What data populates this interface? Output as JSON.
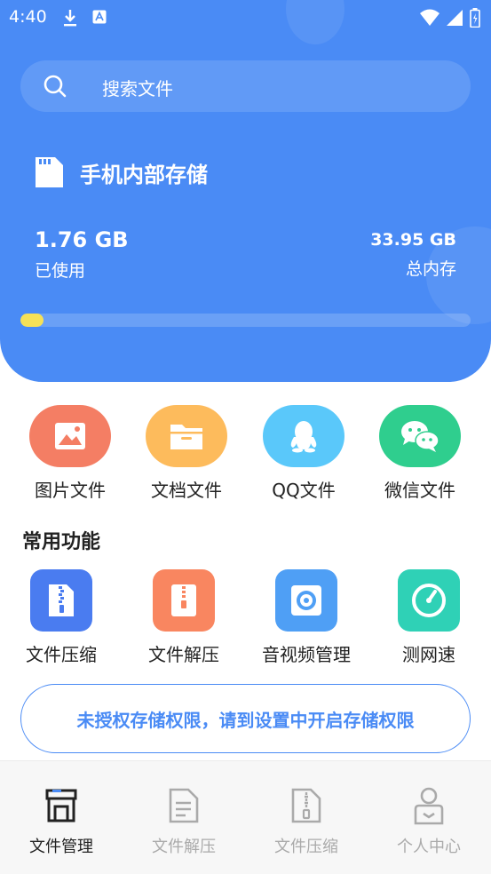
{
  "status_bar": {
    "time": "4:40"
  },
  "search": {
    "placeholder": "搜索文件"
  },
  "storage": {
    "title": "手机内部存储",
    "used_value": "1.76 GB",
    "used_label": "已使用",
    "total_value": "33.95 GB",
    "total_label": "总内存",
    "used_fraction": 0.052,
    "bar_color": "#f6e157"
  },
  "categories": [
    {
      "label": "图片文件",
      "icon": "image-icon",
      "color": "#f47e64"
    },
    {
      "label": "文档文件",
      "icon": "folder-icon",
      "color": "#fdbb5c"
    },
    {
      "label": "QQ文件",
      "icon": "qq-icon",
      "color": "#5ac8fa"
    },
    {
      "label": "微信文件",
      "icon": "wechat-icon",
      "color": "#2fce8e"
    }
  ],
  "section_title": "常用功能",
  "functions": [
    {
      "label": "文件压缩",
      "icon": "zip-file-icon",
      "color": "#4a7cf0"
    },
    {
      "label": "文件解压",
      "icon": "unzip-icon",
      "color": "#f98660"
    },
    {
      "label": "音视频管理",
      "icon": "disc-icon",
      "color": "#4f9ff5"
    },
    {
      "label": "测网速",
      "icon": "speedometer-icon",
      "color": "#2fd1b6"
    }
  ],
  "permission_button": "未授权存储权限，请到设置中开启存储权限",
  "tabs": [
    {
      "label": "文件管理",
      "icon": "store-icon",
      "active": true
    },
    {
      "label": "文件解压",
      "icon": "document-icon",
      "active": false
    },
    {
      "label": "文件压缩",
      "icon": "zip-document-icon",
      "active": false
    },
    {
      "label": "个人中心",
      "icon": "profile-icon",
      "active": false
    }
  ],
  "colors": {
    "primary": "#4a8bf5",
    "accent": "#f6e157"
  }
}
